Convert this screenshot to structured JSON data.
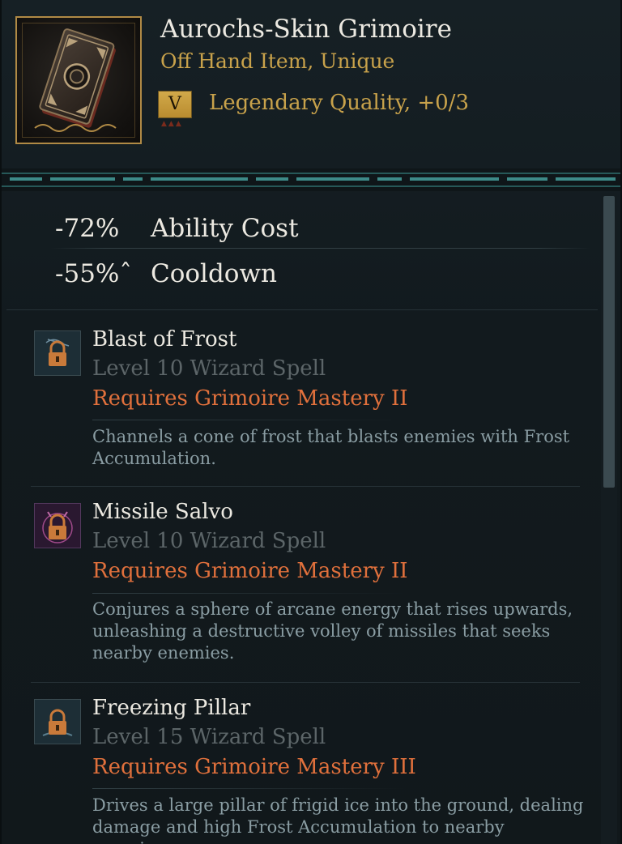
{
  "item": {
    "name": "Aurochs-Skin Grimoire",
    "type": "Off Hand Item, Unique",
    "tier": "V",
    "quality": "Legendary Quality, +0/3",
    "icon": "grimoire-book-icon"
  },
  "stats": [
    {
      "value": "-72%",
      "label": "Ability Cost"
    },
    {
      "value": "-55%ˆ",
      "label": "Cooldown"
    }
  ],
  "spells": [
    {
      "name": "Blast of Frost",
      "level": "Level 10 Wizard Spell",
      "requirement": "Requires Grimoire Mastery II",
      "description": "Channels a cone of frost that blasts enemies with Frost Accumulation.",
      "icon": "frost-lock-icon"
    },
    {
      "name": "Missile Salvo",
      "level": "Level 10 Wizard Spell",
      "requirement": "Requires Grimoire Mastery II",
      "description": "Conjures a sphere of arcane energy that rises upwards, unleashing a destructive volley of missiles that seeks nearby enemies.",
      "icon": "arcane-lock-icon"
    },
    {
      "name": "Freezing Pillar",
      "level": "Level 15 Wizard Spell",
      "requirement": "Requires Grimoire Mastery III",
      "description": "Drives a large pillar of frigid ice into the ground, dealing damage and high Frost Accumulation to nearby enemies.",
      "icon": "ice-pillar-lock-icon"
    }
  ],
  "colors": {
    "gold": "#c8a24b",
    "requirement": "#e0703c",
    "muted": "#5c6568",
    "description": "#8a9da3"
  }
}
